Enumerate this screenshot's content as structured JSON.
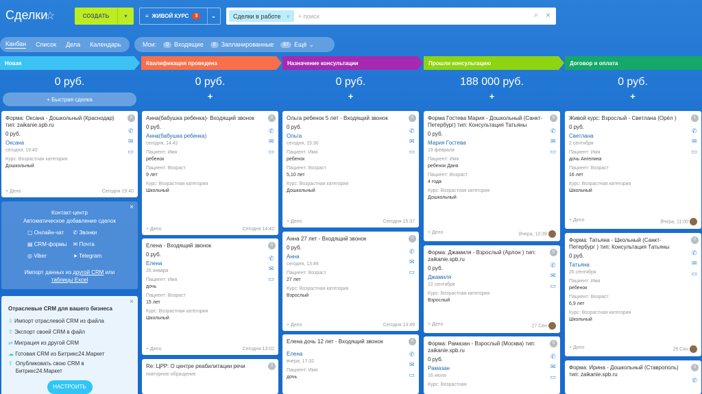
{
  "header": {
    "title": "Сделки",
    "create_label": "СОЗДАТЬ",
    "filter_label": "ЖИВОЙ КУРС",
    "filter_count": "3",
    "search_chip": "Сделки в работе",
    "search_placeholder": "+ поиск"
  },
  "tabs": [
    "Канбан",
    "Список",
    "Дела",
    "Календарь"
  ],
  "mine": {
    "label": "Мои:",
    "incoming_count": "0",
    "incoming": "Входящие",
    "planned_count": "0",
    "planned": "Запланированные",
    "more_count": "67",
    "more": "Ещё"
  },
  "columns": [
    {
      "stage": "Новая",
      "color": "#3cc3f4",
      "sum": "0 руб.",
      "quick": "Быстрая сделка"
    },
    {
      "stage": "Квалификация проведена",
      "color": "#f86f4a",
      "sum": "0 руб."
    },
    {
      "stage": "Назначение консультации",
      "color": "#a62ab0",
      "sum": "0 руб."
    },
    {
      "stage": "Прошли консультацию",
      "color": "#8ed411",
      "sum": "188 000 руб."
    },
    {
      "stage": "Договор и оплата",
      "color": "#15a868",
      "sum": "0 руб."
    }
  ],
  "cards": {
    "c1": {
      "title": "Форма: Оксана - Дошкольный (Краснодар) тип: zaikanie.spb.ru",
      "amount": "0 руб.",
      "contact": "Оксана",
      "date": "сегодня, 19:40",
      "f1l": "Курс: Возрастная категория",
      "f1v": "Дошкольный",
      "add": "+ Дело",
      "when": "Сегодня 19:40",
      "count": "0"
    },
    "c2": {
      "title": "Анна(бабушка ребенка)- Входящий звонок",
      "amount": "0 руб.",
      "contact": "Анна(бабушка ребенка)",
      "date": "сегодня, 14:42",
      "f1l": "Пациент: Имя",
      "f1v": "ребенок",
      "f2l": "Пациент: Возраст",
      "f2v": "9 лет",
      "f3l": "Курс: Возрастная категория",
      "f3v": "Школьный",
      "add": "+ Дело",
      "when": "Сегодня 14:42",
      "count": "0"
    },
    "c3": {
      "title": "Елена - Входящий звонок",
      "amount": "0 руб.",
      "contact": "Елена",
      "date": "26 января",
      "f1l": "Пациент: Имя",
      "f1v": "дочь",
      "f2l": "Пациент: Возраст",
      "f2v": "15 лет",
      "f3l": "Курс: Возрастная категория",
      "f3v": "Школьный",
      "add": "+ Дело",
      "when": "Сегодня 13:02",
      "count": "0"
    },
    "c4": {
      "title": "Re: ЦРР: О центре реабилитации речи",
      "sub": "повторное обращение",
      "count": "0"
    },
    "c5": {
      "title": "Ольга ребенок 5 лет - Входящий звонок",
      "amount": "0 руб.",
      "contact": "Ольга",
      "date": "сегодня, 15:36",
      "f1l": "Пациент: Имя",
      "f1v": "ребенок",
      "f2l": "Пациент: Возраст",
      "f2v": "5,10 лет",
      "f3l": "Курс: Возрастная категория",
      "f3v": "Дошкольный",
      "add": "+ Дело",
      "when": "Сегодня 15:37",
      "count": "0"
    },
    "c6": {
      "title": "Анна 27 лет - Входящий звонок",
      "amount": "0 руб.",
      "contact": "Анна",
      "date": "сегодня, 13:49",
      "f1l": "Пациент: Возраст",
      "f1v": "27 лет",
      "f2l": "Курс: Возрастная категория",
      "f2v": "Взрослый",
      "add": "+ Дело",
      "when": "Сегодня 13:49",
      "count": "0"
    },
    "c7": {
      "title": "Елена дочь 12 лет - Входящий звонок",
      "amount": "0 руб.",
      "contact": "Елена",
      "date": "вчера, 17:32",
      "f1l": "Пациент: Имя",
      "f1v": "дочь",
      "count": "0"
    },
    "c8": {
      "title": "Форма Гостева Мария - Дошкольный (Санкт-Петербург) тип: Консультация Татьяны",
      "amount": "0 руб.",
      "contact": "Мария Гостева",
      "date": "19 февраля",
      "f1l": "Пациент: Имя",
      "f1v": "ребенок Даня",
      "f2l": "Пациент: Возраст",
      "f2v": "4 года",
      "f3l": "Курс: Возрастная категория",
      "f3v": "Дошкольный",
      "add": "+ Дело",
      "when": "Вчера, 10:39",
      "count": "0"
    },
    "c9": {
      "title": "Форма: Джамиля - Взрослый (Арлон ) тип: zaikanie.spb.ru",
      "amount": "0 руб.",
      "contact": "Джамиля",
      "date": "22 сентября",
      "f1l": "Курс: Возрастная категория",
      "f1v": "Взрослый",
      "add": "+ Дело",
      "when": "27 Сен",
      "count": "0"
    },
    "c10": {
      "title": "Форма: Рамазан - Взрослый (Москва) тип: zaikanie.spb.ru",
      "amount": "0 руб.",
      "contact": "Рамазан",
      "date": "16 июля",
      "f1l": "Курс: Возрастная",
      "count": "0"
    },
    "c11": {
      "title": "Живой курс: Взрослый - Светлана (Орёл )",
      "amount": "0 руб.",
      "contact": "Светлана",
      "date": "2 сентября",
      "f1l": "Пациент: Имя",
      "f1v": "дочь Ангелина",
      "f2l": "Пациент: Возраст",
      "f2v": "16 лет",
      "f3l": "Курс: Возрастная категория",
      "f3v": "Школьный",
      "add": "+ Дело",
      "when": "Вчера, 11:00",
      "count": "1"
    },
    "c12": {
      "title": "Форма: Татьяна - Школьный (Санкт-Петербург ) тип: Консультация Татьяны",
      "amount": "0 руб.",
      "contact": "Татьяна",
      "date": "26 сентября",
      "f1l": "Пациент: Имя",
      "f1v": "ребенок",
      "f2l": "Пациент: Возраст",
      "f2v": "6,9 лет",
      "f3l": "Курс: Возрастная категория",
      "f3v": "Школьный",
      "add": "+ Дело",
      "when": "26 Сен",
      "count": "0"
    },
    "c13": {
      "title": "Форма: Ирина - Дошкольный (Ставрополь) тип: zaikanie.spb.ru",
      "count": "0"
    }
  },
  "contact_center": {
    "title": "Контакт-центр",
    "subtitle": "Автоматическое добавление сделок",
    "items": [
      "Онлайн-чат",
      "Звонки",
      "CRM-формы",
      "Почта",
      "Viber",
      "Telegram"
    ],
    "import_text": "Импорт данных из",
    "import_link1": "другой CRM",
    "import_or": "или",
    "import_link2": "таблицы Excel"
  },
  "industry": {
    "title": "Отраслевые CRM для вашего бизнеса",
    "items": [
      "Импорт отраслевой CRM из файла",
      "Экспорт своей CRM в файл",
      "Миграция из другой CRM",
      "Готовая CRM из Битрикс24.Маркет",
      "Опубликовать свою CRM в Битрикс24.Маркет"
    ],
    "button": "НАСТРОИТЬ"
  }
}
